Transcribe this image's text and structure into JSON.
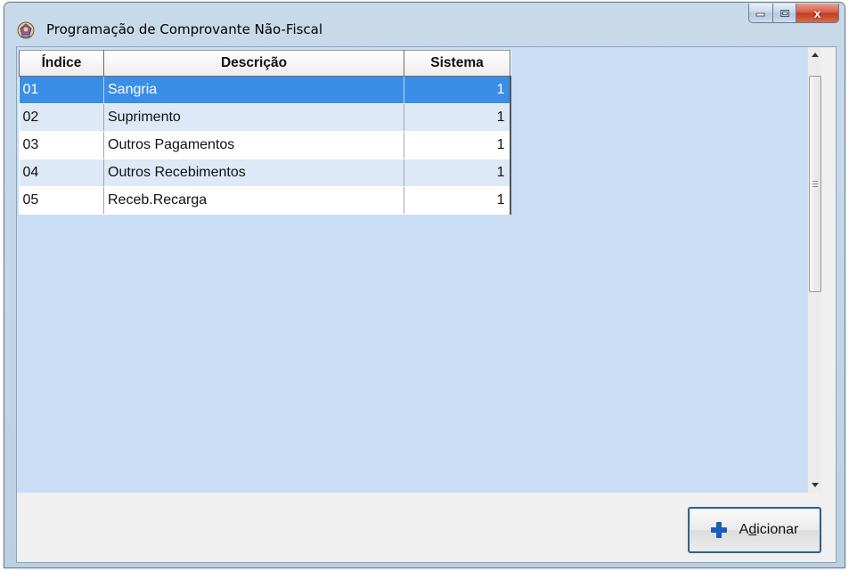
{
  "window": {
    "title": "Programação de Comprovante Não-Fiscal",
    "close_label": "x"
  },
  "grid": {
    "columns": [
      "Índice",
      "Descrição",
      "Sistema"
    ],
    "rows": [
      {
        "indice": "01",
        "descricao": "Sangria",
        "sistema": "1",
        "selected": true
      },
      {
        "indice": "02",
        "descricao": "Suprimento",
        "sistema": "1"
      },
      {
        "indice": "03",
        "descricao": "Outros Pagamentos",
        "sistema": "1"
      },
      {
        "indice": "04",
        "descricao": "Outros Recebimentos",
        "sistema": "1"
      },
      {
        "indice": "05",
        "descricao": "Receb.Recarga",
        "sistema": "1"
      }
    ]
  },
  "footer": {
    "add_button": {
      "prefix": "A",
      "accel": "d",
      "suffix": "icionar"
    }
  },
  "colors": {
    "selection": "#3a8ee6",
    "grid_background": "#c9def4",
    "alt_row": "#dde9f6",
    "add_icon": "#1a5db8"
  },
  "icons": [
    "app-icon",
    "minimize-icon",
    "maximize-icon",
    "close-icon",
    "scroll-up-icon",
    "scroll-down-icon",
    "plus-icon"
  ]
}
